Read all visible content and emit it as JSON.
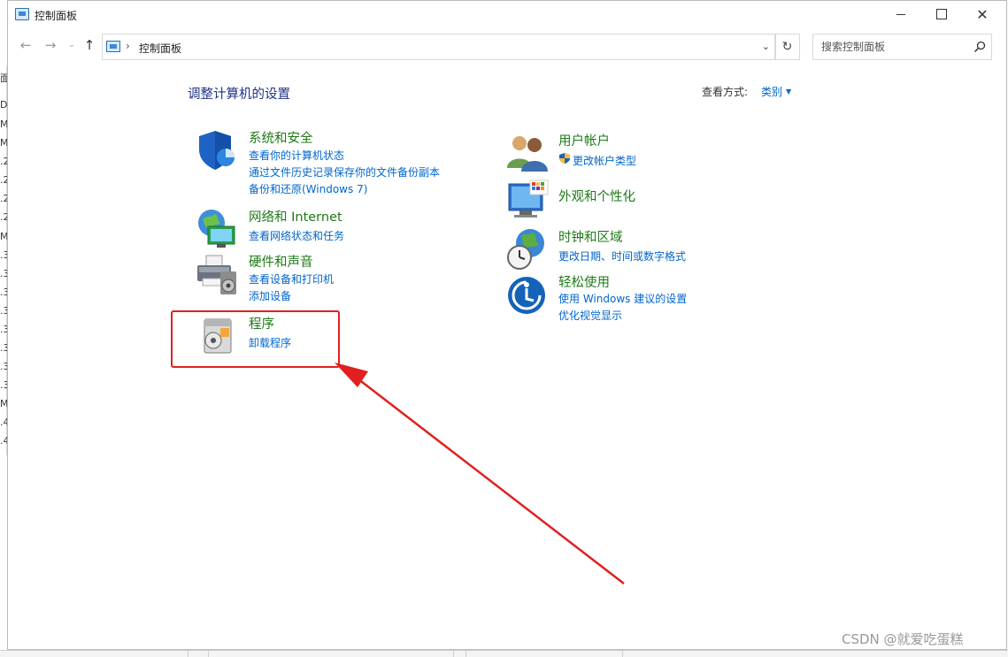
{
  "window": {
    "title": "控制面板",
    "minimize_icon": "minimize-icon",
    "maximize_icon": "maximize-icon",
    "close_icon": "close-icon",
    "close_glyph": "✕"
  },
  "nav": {
    "back_glyph": "←",
    "forward_glyph": "→",
    "recent_glyph": "⌄",
    "up_glyph": "↑",
    "breadcrumb_separator": "›",
    "path": "控制面板",
    "refresh_glyph": "↻",
    "dropdown_glyph": "⌄",
    "search_placeholder": "搜索控制面板"
  },
  "main": {
    "heading": "调整计算机的设置",
    "view_by_label": "查看方式:",
    "view_by_value": "类别",
    "categories_left": [
      {
        "icon": "shield-icon",
        "title": "系统和安全",
        "links": [
          "查看你的计算机状态",
          "通过文件历史记录保存你的文件备份副本",
          "备份和还原(Windows 7)"
        ]
      },
      {
        "icon": "network-icon",
        "title": "网络和 Internet",
        "links": [
          "查看网络状态和任务"
        ]
      },
      {
        "icon": "printer-icon",
        "title": "硬件和声音",
        "links": [
          "查看设备和打印机",
          "添加设备"
        ]
      },
      {
        "icon": "programs-icon",
        "title": "程序",
        "links": [
          "卸载程序"
        ]
      }
    ],
    "categories_right": [
      {
        "icon": "users-icon",
        "title": "用户帐户",
        "links": [
          "更改帐户类型"
        ]
      },
      {
        "icon": "appearance-icon",
        "title": "外观和个性化",
        "links": []
      },
      {
        "icon": "clock-globe-icon",
        "title": "时钟和区域",
        "links": [
          "更改日期、时间或数字格式"
        ]
      },
      {
        "icon": "ease-of-access-icon",
        "title": "轻松使用",
        "links": [
          "使用 Windows 建议的设置",
          "优化视觉显示"
        ]
      }
    ]
  },
  "annotation": {
    "highlight_color": "#e02020"
  },
  "colors": {
    "link": "#0066cc",
    "category_title": "#1f7a16",
    "heading": "#1e3287"
  },
  "watermark": "CSDN @就爱吃蛋糕",
  "background_fragments": [
    "面",
    "DE",
    "M",
    "M",
    ".2",
    ".2",
    ".2",
    ".2",
    "M",
    ".3",
    ".3",
    ".3",
    ".3",
    ".3",
    ".3",
    ".3",
    ".3",
    "M",
    ".4",
    ".4"
  ]
}
